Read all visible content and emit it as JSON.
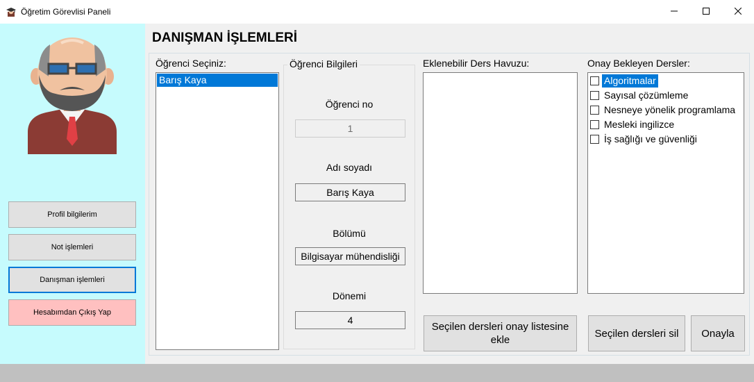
{
  "window": {
    "title": "Öğretim Görevlisi Paneli",
    "minimize_glyph": "—",
    "maximize_glyph": "☐",
    "close_glyph": "✕"
  },
  "sidebar": {
    "background": "#c6fbfd",
    "buttons": [
      {
        "label": "Profil bilgilerim"
      },
      {
        "label": "Not işlemleri"
      },
      {
        "label": "Danışman işlemleri"
      },
      {
        "label": "Hesabımdan Çıkış Yap"
      }
    ]
  },
  "main": {
    "title": "DANIŞMAN İŞLEMLERİ",
    "student_select": {
      "label": "Öğrenci Seçiniz:",
      "items": [
        "Barış Kaya"
      ],
      "selected_index": 0
    },
    "student_info": {
      "caption": "Öğrenci Bilgileri",
      "no_label": "Öğrenci no",
      "no_value": "1",
      "name_label": "Adı soyadı",
      "name_value": "Barış Kaya",
      "dept_label": "Bölümü",
      "dept_value": "Bilgisayar mühendisliği",
      "term_label": "Dönemi",
      "term_value": "4"
    },
    "course_pool": {
      "label": "Eklenebilir Ders Havuzu:",
      "add_button": "Seçilen dersleri onay listesine ekle"
    },
    "pending": {
      "label": "Onay Bekleyen Dersler:",
      "items": [
        {
          "text": "Algoritmalar",
          "checked": false,
          "selected": true
        },
        {
          "text": "Sayısal çözümleme",
          "checked": false,
          "selected": false
        },
        {
          "text": "Nesneye yönelik programlama",
          "checked": false,
          "selected": false
        },
        {
          "text": "Mesleki ingilizce",
          "checked": false,
          "selected": false
        },
        {
          "text": "İş sağlığı ve güvenliği",
          "checked": false,
          "selected": false
        }
      ],
      "delete_button": "Seçilen dersleri sil",
      "approve_button": "Onayla"
    }
  },
  "colors": {
    "accent": "#0078d7",
    "logout_button": "#ffc0c0",
    "panel_bg": "#f0f0f0"
  }
}
